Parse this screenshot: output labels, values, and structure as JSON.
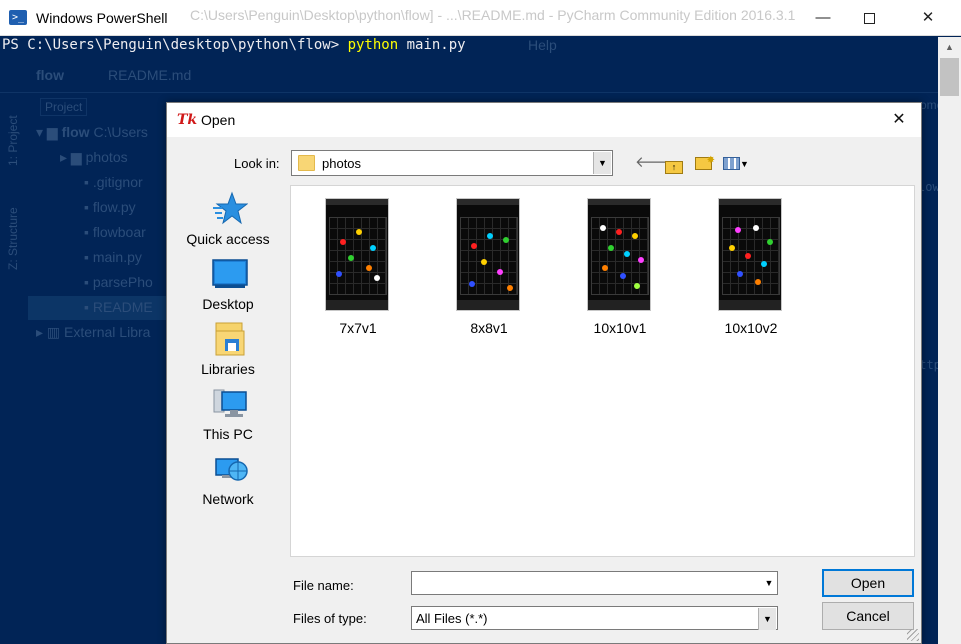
{
  "powershell": {
    "title": "Windows PowerShell",
    "icon": "powershell-icon",
    "prompt": "PS C:\\Users\\Penguin\\desktop\\python\\flow> ",
    "command": "python",
    "command_args": " main.py",
    "controls": {
      "minimize": "—",
      "maximize": "",
      "close": "✕"
    }
  },
  "pycharm_background": {
    "window_title": "C:\\Users\\Penguin\\Desktop\\python\\flow] - ...\\README.md - PyCharm Community Edition 2016.3.1",
    "menu_help": "Help",
    "breadcrumb": [
      "flow",
      "README.md"
    ],
    "project_tab": "Project",
    "side_tabs": [
      "1: Project",
      "Z: Structure"
    ],
    "tree": [
      {
        "label": "flow",
        "path": "C:\\Users",
        "indent": 0
      },
      {
        "label": "photos",
        "indent": 1
      },
      {
        "label": ".gitignor",
        "indent": 1
      },
      {
        "label": "flow.py",
        "indent": 1
      },
      {
        "label": "flowboar",
        "indent": 1
      },
      {
        "label": "main.py",
        "indent": 1
      },
      {
        "label": "parsePho",
        "indent": 1
      },
      {
        "label": "README",
        "indent": 1
      },
      {
        "label": "External Libra",
        "indent": 0
      }
    ],
    "right_fragments": [
      "ome",
      "low",
      "http"
    ]
  },
  "dialog": {
    "title": "Open",
    "tk_icon": "Tk",
    "close": "✕",
    "look_in": {
      "label": "Look in:",
      "value": "photos"
    },
    "toolbar": {
      "back": "🡐",
      "up_icon": "folder-up-icon",
      "new_folder_icon": "new-folder-icon",
      "view_icon": "view-menu-icon"
    },
    "places": [
      {
        "label": "Quick access",
        "icon": "quick-access-icon"
      },
      {
        "label": "Desktop",
        "icon": "desktop-icon"
      },
      {
        "label": "Libraries",
        "icon": "libraries-icon"
      },
      {
        "label": "This PC",
        "icon": "this-pc-icon"
      },
      {
        "label": "Network",
        "icon": "network-icon"
      }
    ],
    "files": [
      {
        "name": "7x7v1"
      },
      {
        "name": "8x8v1"
      },
      {
        "name": "10x10v1"
      },
      {
        "name": "10x10v2"
      }
    ],
    "file_name": {
      "label": "File name:",
      "value": ""
    },
    "file_type": {
      "label": "Files of type:",
      "value": "All Files (*.*)"
    },
    "buttons": {
      "open": "Open",
      "cancel": "Cancel"
    }
  },
  "colors": {
    "powershell_bg": "#012456",
    "command": "#ffff00",
    "dialog_bg": "#f0f0f0",
    "accent": "#0078d7"
  }
}
